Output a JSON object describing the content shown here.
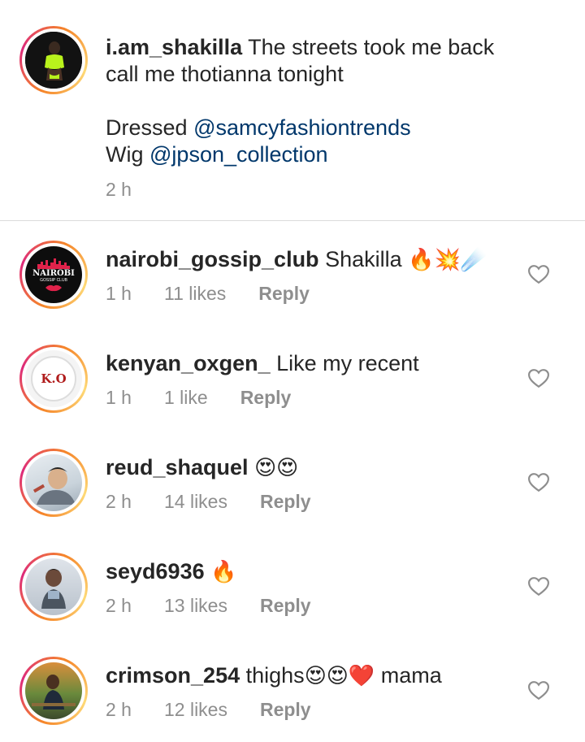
{
  "caption": {
    "username": "i.am_shakilla",
    "line1": "The streets took me back",
    "line2": "call me thotianna tonight",
    "dressed_label": "Dressed",
    "dressed_mention": "@samcyfashiontrends",
    "wig_label": "Wig",
    "wig_mention": "@jpson_collection",
    "time": "2 h"
  },
  "comments": [
    {
      "username": "nairobi_gossip_club",
      "text": "Shakilla",
      "emoji": "🔥💥☄️",
      "time": "1 h",
      "likes": "11 likes",
      "reply": "Reply",
      "avatar_label1": "NAIROBI",
      "avatar_label2": "GOSSIP CLUB"
    },
    {
      "username": "kenyan_oxgen_",
      "text": "Like my recent",
      "emoji": "",
      "time": "1 h",
      "likes": "1 like",
      "reply": "Reply",
      "avatar_label1": "K.O"
    },
    {
      "username": "reud_shaquel",
      "text": "",
      "emoji": "😍😍",
      "time": "2 h",
      "likes": "14 likes",
      "reply": "Reply"
    },
    {
      "username": "seyd6936",
      "text": "",
      "emoji": "🔥",
      "time": "2 h",
      "likes": "13 likes",
      "reply": "Reply"
    },
    {
      "username": "crimson_254",
      "text": "thighs",
      "emoji": "😍😍❤️",
      "text2": "mama",
      "time": "2 h",
      "likes": "12 likes",
      "reply": "Reply"
    }
  ],
  "colors": {
    "mention": "#00376b",
    "meta": "#8e8e8e",
    "ring_start": "#f58529",
    "ring_end": "#dd2a7b"
  }
}
